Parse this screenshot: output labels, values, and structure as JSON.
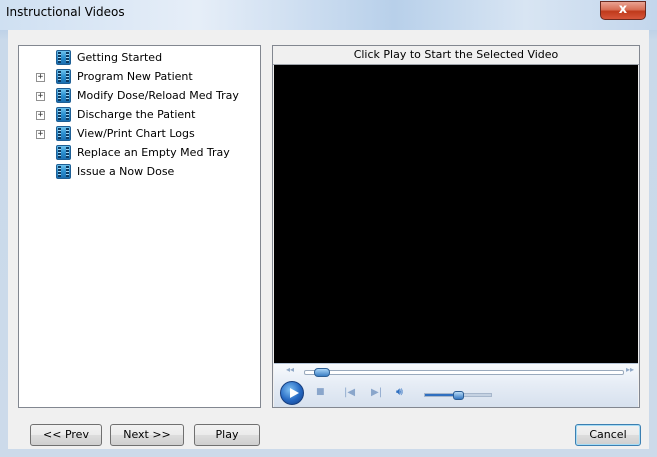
{
  "window": {
    "title": "Instructional Videos",
    "close_glyph": "x"
  },
  "tree": {
    "items": [
      {
        "label": "Getting Started",
        "expandable": false
      },
      {
        "label": "Program New Patient",
        "expandable": true
      },
      {
        "label": "Modify Dose/Reload Med Tray",
        "expandable": true
      },
      {
        "label": "Discharge the Patient",
        "expandable": true
      },
      {
        "label": "View/Print Chart Logs",
        "expandable": true
      },
      {
        "label": "Replace an Empty Med Tray",
        "expandable": false
      },
      {
        "label": "Issue a Now Dose",
        "expandable": false
      }
    ],
    "expander_glyph": "+"
  },
  "player": {
    "caption": "Click Play to Start the Selected Video",
    "seek_position": 0.03,
    "volume_level": 0.5
  },
  "buttons": {
    "prev": "<< Prev",
    "next": "Next >>",
    "play": "Play",
    "cancel": "Cancel"
  },
  "colors": {
    "accent": "#2568c2",
    "video_bg": "#000000"
  }
}
